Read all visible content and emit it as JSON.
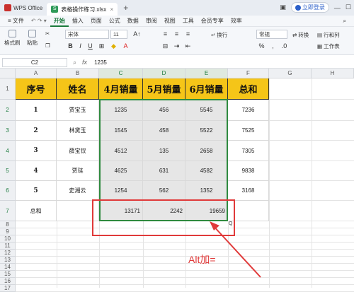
{
  "titlebar": {
    "app_name": "WPS Office",
    "file_name": "表格操作练习.xlsx",
    "new_tab": "+",
    "login": "立即登录"
  },
  "menu": {
    "file": "≡ 文件",
    "items": [
      "开始",
      "插入",
      "页面",
      "公式",
      "数据",
      "审阅",
      "视图",
      "工具",
      "会员专享",
      "效率"
    ],
    "active_index": 0
  },
  "toolbar": {
    "format_painter": "格式刷",
    "paste": "粘贴",
    "font_name": "宋体",
    "font_size": "11",
    "wrap": "换行",
    "number_format": "常规",
    "convert": "转换",
    "rows_cols": "行和列",
    "worksheet": "工作表",
    "bold": "B",
    "italic": "I",
    "underline": "U",
    "font_color": "A"
  },
  "formula_bar": {
    "cell_ref": "C2",
    "fx": "fx",
    "value": "1235"
  },
  "columns": [
    "A",
    "B",
    "C",
    "D",
    "E",
    "F",
    "G",
    "H"
  ],
  "rows": [
    "1",
    "2",
    "3",
    "4",
    "5",
    "6",
    "7",
    "8",
    "9",
    "10",
    "11",
    "12",
    "13",
    "14",
    "15",
    "16",
    "17"
  ],
  "table": {
    "headers": [
      "序号",
      "姓名",
      "4月销量",
      "5月销量",
      "6月销量",
      "总和"
    ],
    "data": [
      [
        "1",
        "贾宝玉",
        "1235",
        "456",
        "5545",
        "7236"
      ],
      [
        "2",
        "林黛玉",
        "1545",
        "458",
        "5522",
        "7525"
      ],
      [
        "3",
        "薛宝钗",
        "4512",
        "135",
        "2658",
        "7305"
      ],
      [
        "4",
        "贾琏",
        "4625",
        "631",
        "4582",
        "9838"
      ],
      [
        "5",
        "史湘云",
        "1254",
        "562",
        "1352",
        "3168"
      ]
    ],
    "total_label": "总和",
    "totals": [
      "13171",
      "2242",
      "19659"
    ]
  },
  "quick_icon": "Q",
  "annotation": "Alt加=",
  "colors": {
    "header_fill": "#f5c518",
    "selection": "#2f8a3f",
    "highlight": "#e03a3a",
    "accent": "#1a7a3c"
  }
}
